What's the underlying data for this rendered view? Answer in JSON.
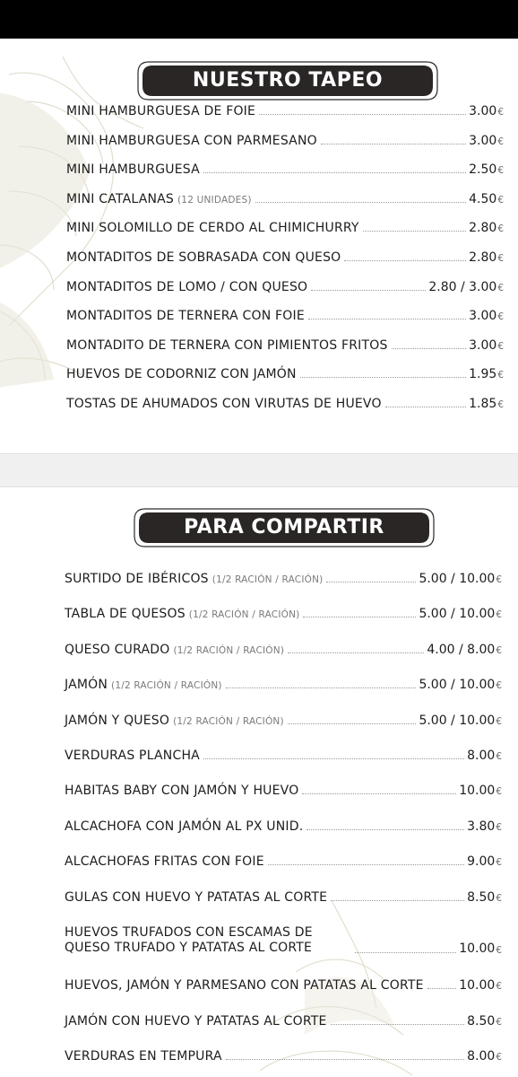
{
  "sections": [
    {
      "title": "NUESTRO TAPEO",
      "currency": "€",
      "items": [
        {
          "name": "MINI HAMBURGUESA DE FOIE",
          "note": "",
          "price": "3.00"
        },
        {
          "name": "MINI HAMBURGUESA CON PARMESANO",
          "note": "",
          "price": "3.00"
        },
        {
          "name": "MINI HAMBURGUESA",
          "note": "",
          "price": "2.50"
        },
        {
          "name": "MINI CATALANAS",
          "note": "(12 UNIDADES)",
          "price": "4.50"
        },
        {
          "name": "MINI SOLOMILLO DE CERDO AL CHIMICHURRY",
          "note": "",
          "price": "2.80"
        },
        {
          "name": "MONTADITOS DE SOBRASADA CON QUESO",
          "note": "",
          "price": "2.80"
        },
        {
          "name": "MONTADITOS DE LOMO / CON QUESO",
          "note": "",
          "price": "2.80 / 3.00"
        },
        {
          "name": "MONTADITOS DE TERNERA CON FOIE",
          "note": "",
          "price": "3.00"
        },
        {
          "name": "MONTADITO DE TERNERA CON PIMIENTOS FRITOS",
          "note": "",
          "price": "3.00"
        },
        {
          "name": "HUEVOS DE CODORNIZ CON JAMÓN",
          "note": "",
          "price": "1.95"
        },
        {
          "name": "TOSTAS DE AHUMADOS CON VIRUTAS DE HUEVO",
          "note": "",
          "price": "1.85"
        }
      ]
    },
    {
      "title": "PARA COMPARTIR",
      "currency": "€",
      "items": [
        {
          "name": "SURTIDO DE IBÉRICOS",
          "note": "(1/2 RACIÓN / RACIÓN)",
          "price": "5.00 / 10.00"
        },
        {
          "name": "TABLA DE QUESOS",
          "note": "(1/2 RACIÓN / RACIÓN)",
          "price": "5.00 / 10.00"
        },
        {
          "name": "QUESO CURADO",
          "note": "(1/2 RACIÓN / RACIÓN)",
          "price": "4.00 / 8.00"
        },
        {
          "name": "JAMÓN",
          "note": "(1/2 RACIÓN / RACIÓN)",
          "price": "5.00 / 10.00"
        },
        {
          "name": "JAMÓN Y QUESO",
          "note": "(1/2 RACIÓN / RACIÓN)",
          "price": "5.00 / 10.00"
        },
        {
          "name": "VERDURAS PLANCHA",
          "note": "",
          "price": "8.00"
        },
        {
          "name": "HABITAS BABY CON JAMÓN Y HUEVO",
          "note": "",
          "price": "10.00"
        },
        {
          "name": "ALCACHOFA CON JAMÓN AL PX UNID.",
          "note": "",
          "price": "3.80"
        },
        {
          "name": "ALCACHOFAS FRITAS CON FOIE",
          "note": "",
          "price": "9.00"
        },
        {
          "name": "GULAS CON HUEVO Y PATATAS AL CORTE",
          "note": "",
          "price": "8.50"
        },
        {
          "name": "HUEVOS TRUFADOS CON ESCAMAS DE QUESO TRUFADO Y PATATAS AL CORTE",
          "note": "",
          "price": "10.00"
        },
        {
          "name": "HUEVOS, JAMÓN Y PARMESANO CON PATATAS AL CORTE",
          "note": "",
          "price": "10.00"
        },
        {
          "name": "JAMÓN CON HUEVO Y PATATAS AL CORTE",
          "note": "",
          "price": "8.50"
        },
        {
          "name": "VERDURAS EN TEMPURA",
          "note": "",
          "price": "8.00"
        }
      ]
    }
  ]
}
